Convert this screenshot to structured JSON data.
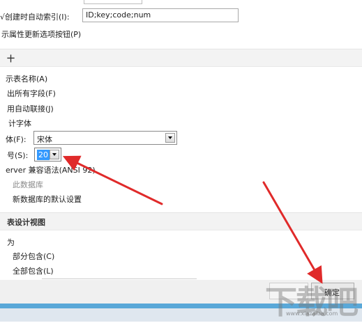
{
  "index_fields": {
    "label": "√创建时自动索引(I):",
    "value": "ID;key;code;num"
  },
  "show_property_update_button_label": "示属性更新选项按钮(P)",
  "section_design": "十",
  "options": {
    "show_table_name": "示表名称(A)",
    "show_all_fields": "出所有字段(F)",
    "enable_auto_join": "用自动联接(J)",
    "design_font_heading": "计字体"
  },
  "font": {
    "label": "体(F):",
    "value": "宋体"
  },
  "size": {
    "label": "号(S):",
    "value": "20"
  },
  "sql_server_label": "erver 兼容语法(ANSI 92)",
  "this_database_label": "此数据库",
  "new_database_default_label": "新数据库的默认设置",
  "section_table_view": "表设计视图",
  "behavior_heading": "为",
  "partial_include_label": "部分包含(C)",
  "full_include_label": "全部包含(L)",
  "ok_button_label": "确定",
  "watermark": {
    "text": "下载吧",
    "url": "www.xiazaiba.com"
  },
  "colors": {
    "accent": "#3399ff",
    "arrow": "#e02a2a",
    "band": "#5aa8d8"
  }
}
